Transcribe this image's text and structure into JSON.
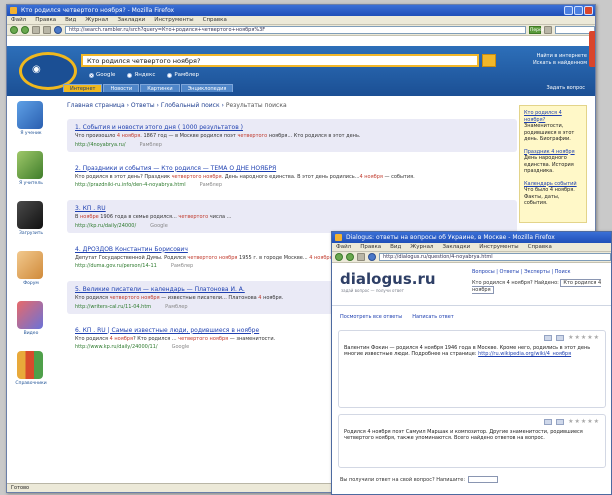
{
  "main": {
    "title": "Кто родился четвертого ноября? - Mozilla Firefox",
    "menu": [
      "Файл",
      "Правка",
      "Вид",
      "Журнал",
      "Закладки",
      "Инструменты",
      "Справка"
    ],
    "address": "http://search.rambler.ru/srch?query=Кто+родился+четвертого+ноября%3F",
    "go": "Перейти",
    "search_query": "Кто родился четвертого ноября?",
    "engines": [
      "Google",
      "Яндекс",
      "Рамблер"
    ],
    "site_links": [
      "Найти в интернете",
      "Искать в найденном"
    ],
    "tabs": [
      "Интернет",
      "Новости",
      "Картинки",
      "Энциклопедия"
    ],
    "help_link": "Задать вопрос",
    "nav": [
      "Я ученик",
      "Я учитель",
      "Загрузить",
      "Форум",
      "Видео",
      "Справочники"
    ],
    "breadcrumb": [
      "Главная страница",
      "Ответы",
      "Глобальный поиск",
      "Результаты поиска"
    ],
    "results": [
      {
        "title": "1. События и новости этого дня ( 1000 результатов )",
        "snippet_a": "Что произошло ",
        "snippet_em": "4 ноября",
        "snippet_b": ". 1867 год — в Москве родился поэт ",
        "snippet_em2": "четвертого",
        "snippet_c": " ноября... Кто родился в этот день.",
        "url": "http://4noyabrya.ru/",
        "source": "Рамблер"
      },
      {
        "title": "2. Праздники и события — Кто родился — ТЕМА О ДНЕ НОЯБРЯ",
        "snippet_a": "Кто родился в этот день? Праздник ",
        "snippet_em": "четвертого ноября",
        "snippet_b": ". День народного единства. В этот день родились...",
        "snippet_em2": "4 ноября",
        "snippet_c": " — события.",
        "url": "http://prazdniki-ru.info/den-4-noyabrya.html",
        "source": "Рамблер"
      },
      {
        "title": "3. КП . RU",
        "snippet_a": "В ",
        "snippet_em": "ноябре",
        "snippet_b": " 1906 года в семье родился... ",
        "snippet_em2": "четвертого",
        "snippet_c": " числа ...",
        "url": "http://kp.ru/daily/24000/",
        "source": "Google"
      },
      {
        "title": "4. ДРОЗДОВ Константин Борисович",
        "snippet_a": "Депутат Государственной Думы. Родился ",
        "snippet_em": "четвертого ноября",
        "snippet_b": " 1955 г. в городе Москве... ",
        "snippet_em2": "4 ноября",
        "snippet_c": ".",
        "url": "http://duma.gov.ru/person/14-11",
        "source": "Рамблер"
      },
      {
        "title": "5. Великие писатели — календарь — Платонова И. А.",
        "snippet_a": "Кто родился ",
        "snippet_em": "четвертого ноября",
        "snippet_b": " — известные писатели... Платонова ",
        "snippet_em2": "4",
        "snippet_c": " ноября.",
        "url": "http://writers-cal.ru/11-04.htm",
        "source": "Рамблер"
      },
      {
        "title": "6. КП . RU | Самые известные люди, родившиеся в ноябре",
        "snippet_a": "Кто родился ",
        "snippet_em": "4 ноября",
        "snippet_b": "? Кто родился ... ",
        "snippet_em2": "четвертого ноября",
        "snippet_c": " — знаменитости.",
        "url": "http://www.kp.ru/daily/24000/11/",
        "source": "Google"
      }
    ],
    "ads": [
      {
        "title": "Кто родился 4 ноября?",
        "text": "Знаменитости, родившиеся в этот день. Биографии."
      },
      {
        "title": "Праздник 4 ноября",
        "text": "День народного единства. История праздника."
      },
      {
        "title": "Календарь событий",
        "text": "Что было 4 ноября. Факты, даты, события."
      }
    ],
    "status": "Готово"
  },
  "popup": {
    "title": "Dialogus: ответы на вопросы об Украине, в Москве - Mozilla Firefox",
    "menu": [
      "Файл",
      "Правка",
      "Вид",
      "Журнал",
      "Закладки",
      "Инструменты",
      "Справка"
    ],
    "address": "http://dialogus.ru/question/4-noyabrya.html",
    "logo": "dialogus.ru",
    "tagline": "задай вопрос — получи ответ",
    "menu_links": "Вопросы | Ответы | Эксперты | Поиск",
    "search_text": "Кто родился 4 ноября? Найдено:",
    "search_query": "Кто родился 4 ноября",
    "links": [
      "Посмотреть все ответы",
      "Написать ответ"
    ],
    "answers": [
      {
        "text": "Валентин Фокин — родился 4 ноября 1946 года в Москве. Кроме него, родились в этот день многие известные люди. Подробнее на странице: ",
        "link": "http://ru.wikipedia.org/wiki/4_ноября"
      },
      {
        "text": "Родился 4 ноября поэт Самуил Маршак и композитор. Другие знаменитости, родившиеся четвертого ноября, также упоминаются. Всего найдено ответов на вопрос.",
        "link": ""
      }
    ],
    "footer": "Вы получили ответ на свой вопрос? Напишите:"
  }
}
